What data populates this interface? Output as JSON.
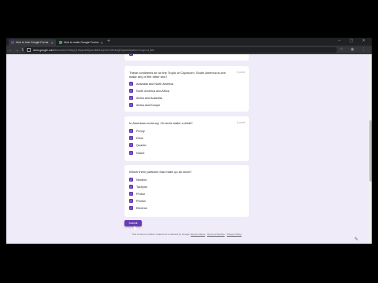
{
  "browser": {
    "tabs": [
      {
        "title": "How to Use Google Forms - Go...",
        "active": true
      },
      {
        "title": "How to make Google Forms quiz...",
        "active": false
      }
    ],
    "url_domain": "docs.google.com",
    "url_rest": "/forms/d/e/1FAIpQLSdqXaBQwe2k8tZxQGd7nHh3cQK9pJd/viewform?usp=sf_link",
    "newtab_glyph": "+",
    "window_controls": "– ▢ ✕"
  },
  "questions": [
    {
      "text": "These continents lie on the Tropic of Capricorn. South America is one make any of the other two?",
      "points": "1 point",
      "options": [
        "Australia and North America",
        "North America and Africa",
        "Africa and Australia",
        "Africa and Europe"
      ]
    },
    {
      "text": "In American currency, 10 cents make a what?",
      "points": "1 point",
      "options": [
        "Penny",
        "Dime",
        "Quarter",
        "Nickel"
      ]
    },
    {
      "text": "Which three particles that make up an atom?",
      "points": "",
      "options": [
        "Neutron",
        "Tachyon",
        "Proton",
        "Photon",
        "Electron"
      ]
    }
  ],
  "form": {
    "submit_label": "Submit",
    "footer_text": "This content is neither created nor endorsed by Google.",
    "footer_links": [
      "Report Abuse",
      "Terms of Service",
      "Privacy Policy"
    ]
  },
  "colors": {
    "accent": "#673ab7",
    "page_bg": "#f0ebf8"
  }
}
